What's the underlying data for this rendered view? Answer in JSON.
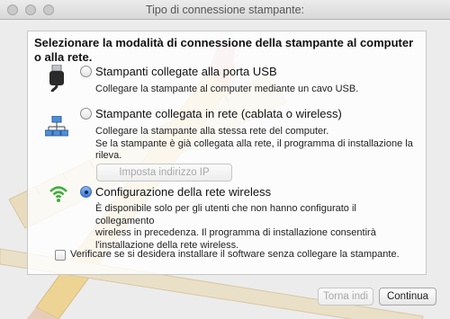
{
  "window": {
    "title": "Tipo di connessione stampante:"
  },
  "heading": "Selezionare la modalità di connessione della stampante al computer o alla rete.",
  "options": [
    {
      "label": "Stampanti collegate alla porta USB",
      "selected": false,
      "icon": "usb-cable-icon",
      "description": "Collegare la stampante al computer mediante un cavo USB."
    },
    {
      "label": "Stampante collegata in rete (cablata o wireless)",
      "selected": false,
      "icon": "network-icon",
      "description_lines": [
        "Collegare la stampante alla stessa rete del computer.",
        "Se la stampante è già collegata alla rete, il programma di installazione la",
        "rileva."
      ],
      "button_label": "Imposta indirizzo IP"
    },
    {
      "label": "Configurazione della rete wireless",
      "selected": true,
      "icon": "wifi-icon",
      "description_lines": [
        "È disponibile solo per gli utenti che non hanno configurato il collegamento",
        "wireless in precedenza. Il programma di installazione consentirà",
        "l'installazione della rete wireless."
      ]
    }
  ],
  "skip_checkbox": {
    "label": "Verificare se si desidera installare il software senza collegare la stampante.",
    "checked": false
  },
  "footer": {
    "back_label": "Torna indi",
    "continue_label": "Continua"
  },
  "colors": {
    "accent": "#3b78d8",
    "window_bg": "#ececec"
  }
}
